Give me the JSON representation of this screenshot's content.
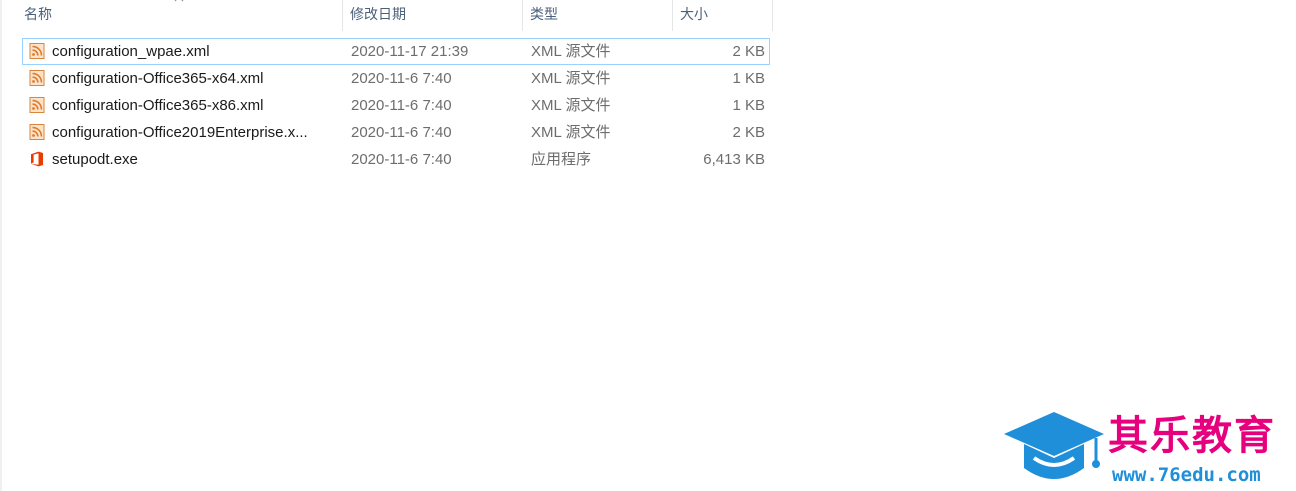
{
  "columns": {
    "name": "名称",
    "date": "修改日期",
    "type": "类型",
    "size": "大小",
    "sort_icon": "chevron-up-icon"
  },
  "files": [
    {
      "name": "configuration_wpae.xml",
      "date": "2020-11-17 21:39",
      "type": "XML 源文件",
      "size": "2 KB",
      "icon": "xml-feed-icon",
      "selected": true
    },
    {
      "name": "configuration-Office365-x64.xml",
      "date": "2020-11-6 7:40",
      "type": "XML 源文件",
      "size": "1 KB",
      "icon": "xml-feed-icon",
      "selected": false
    },
    {
      "name": "configuration-Office365-x86.xml",
      "date": "2020-11-6 7:40",
      "type": "XML 源文件",
      "size": "1 KB",
      "icon": "xml-feed-icon",
      "selected": false
    },
    {
      "name": "configuration-Office2019Enterprise.x...",
      "date": "2020-11-6 7:40",
      "type": "XML 源文件",
      "size": "2 KB",
      "icon": "xml-feed-icon",
      "selected": false
    },
    {
      "name": "setupodt.exe",
      "date": "2020-11-6 7:40",
      "type": "应用程序",
      "size": "6,413 KB",
      "icon": "office-logo-icon",
      "selected": false
    }
  ],
  "colors": {
    "header_text": "#4c607a",
    "selection_border": "#99d1ff",
    "xml_icon": "#e07b2a",
    "office_icon": "#eb3c00",
    "watermark_title": "#e6007e",
    "watermark_url": "#1e8fd8"
  },
  "watermark": {
    "title": "其乐教育",
    "url": "www.76edu.com",
    "icon": "graduation-cap-icon"
  }
}
